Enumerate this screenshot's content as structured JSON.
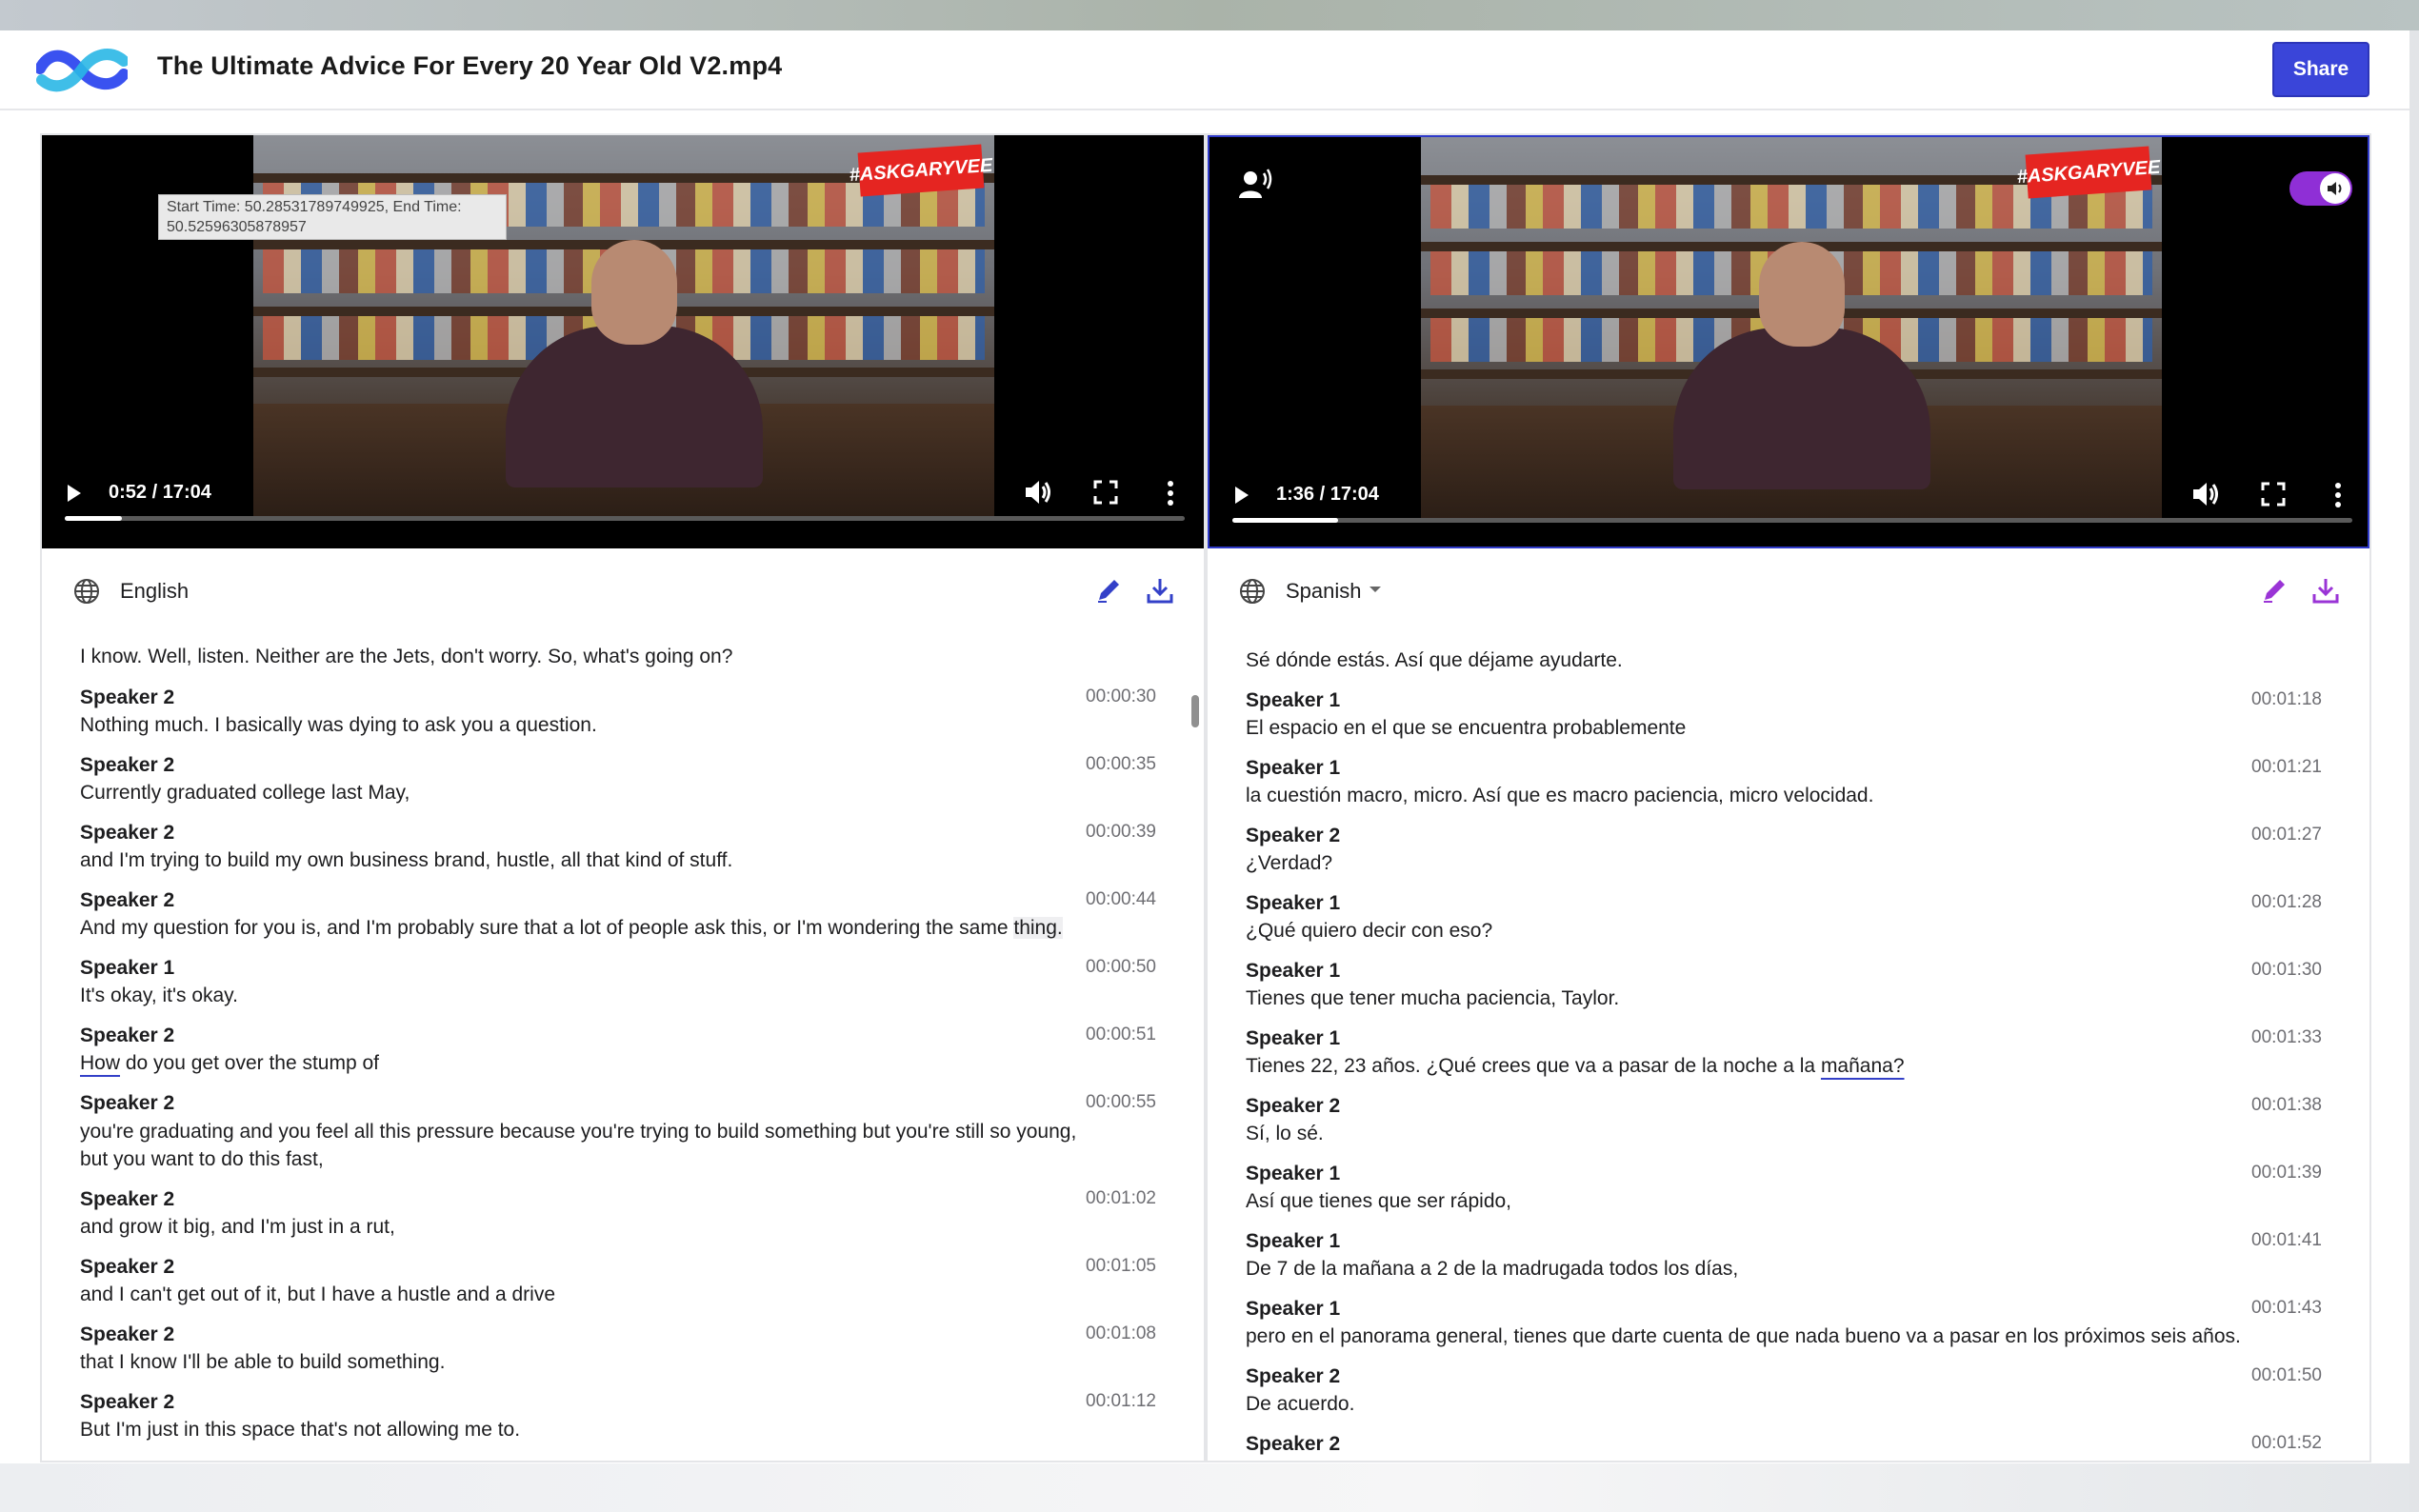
{
  "app": {
    "title": "The Ultimate Advice For Every 20 Year Old V2.mp4",
    "share_label": "Share",
    "accent_color": "#3a45d9"
  },
  "left_panel": {
    "video": {
      "time": "0:52 / 17:04",
      "progress": 0.051,
      "tooltip": "Start Time: 50.28531789749925, End Time: 50.52596305878957",
      "badge": "#ASKGARYVEE"
    },
    "language": "English",
    "transcript": [
      {
        "speaker": "",
        "time": "",
        "text": "I know. Well, listen. Neither are the Jets, don't worry. So, what's going on?"
      },
      {
        "speaker": "Speaker 2",
        "time": "00:00:30",
        "text": "Nothing much. I basically was dying to ask you a question."
      },
      {
        "speaker": "Speaker 2",
        "time": "00:00:35",
        "text": "Currently graduated college last May,"
      },
      {
        "speaker": "Speaker 2",
        "time": "00:00:39",
        "text": "and I'm trying to build my own business brand, hustle, all that kind of stuff."
      },
      {
        "speaker": "Speaker 2",
        "time": "00:00:44",
        "text_pre": "And my question for you is, and I'm probably sure that a lot of people ask this, or I'm wondering the same ",
        "text_hl": "thing."
      },
      {
        "speaker": "Speaker 1",
        "time": "00:00:50",
        "text": "It's okay, it's okay."
      },
      {
        "speaker": "Speaker 2",
        "time": "00:00:51",
        "text_ul": "How",
        "text_post": " do you get over the stump of"
      },
      {
        "speaker": "Speaker 2",
        "time": "00:00:55",
        "text": "you're graduating and you feel all this pressure because you're trying to build something but you're still so young, but you want to do this fast,"
      },
      {
        "speaker": "Speaker 2",
        "time": "00:01:02",
        "text": "and grow it big, and I'm just in a rut,"
      },
      {
        "speaker": "Speaker 2",
        "time": "00:01:05",
        "text": "and I can't get out of it, but I have a hustle and a drive"
      },
      {
        "speaker": "Speaker 2",
        "time": "00:01:08",
        "text": "that I know I'll be able to build something."
      },
      {
        "speaker": "Speaker 2",
        "time": "00:01:12",
        "text": "But I'm just in this space that's not allowing me to."
      }
    ]
  },
  "right_panel": {
    "video": {
      "time": "1:36 / 17:04",
      "progress": 0.094,
      "badge": "#ASKGARYVEE",
      "dub_toggle_on": true
    },
    "language": "Spanish",
    "transcript": [
      {
        "speaker": "",
        "time": "",
        "text": "Sé dónde estás. Así que déjame ayudarte."
      },
      {
        "speaker": "Speaker 1",
        "time": "00:01:18",
        "text": "El espacio en el que se encuentra probablemente"
      },
      {
        "speaker": "Speaker 1",
        "time": "00:01:21",
        "text": "la cuestión macro, micro. Así que es macro paciencia, micro velocidad."
      },
      {
        "speaker": "Speaker 2",
        "time": "00:01:27",
        "text": "¿Verdad?"
      },
      {
        "speaker": "Speaker 1",
        "time": "00:01:28",
        "text": "¿Qué quiero decir con eso?"
      },
      {
        "speaker": "Speaker 1",
        "time": "00:01:30",
        "text": "Tienes que tener mucha paciencia, Taylor."
      },
      {
        "speaker": "Speaker 1",
        "time": "00:01:33",
        "text_pre": "Tienes 22, 23 años. ¿Qué crees que va a pasar de la noche a la ",
        "text_ul": "mañana?"
      },
      {
        "speaker": "Speaker 2",
        "time": "00:01:38",
        "text": "Sí, lo sé."
      },
      {
        "speaker": "Speaker 1",
        "time": "00:01:39",
        "text": "Así que tienes que ser rápido,"
      },
      {
        "speaker": "Speaker 1",
        "time": "00:01:41",
        "text": "De 7 de la mañana a 2 de la madrugada todos los días,"
      },
      {
        "speaker": "Speaker 1",
        "time": "00:01:43",
        "text": "pero en el panorama general, tienes que darte cuenta de que nada bueno va a pasar en los próximos seis años."
      },
      {
        "speaker": "Speaker 2",
        "time": "00:01:50",
        "text": "De acuerdo."
      },
      {
        "speaker": "Speaker 2",
        "time": "00:01:52",
        "text": ""
      }
    ]
  },
  "icons": {
    "logo": "app-logo",
    "globe": "globe-icon",
    "edit": "pencil-icon",
    "download": "download-icon",
    "play": "play-icon",
    "volume": "volume-icon",
    "fullscreen": "fullscreen-icon",
    "more": "more-vertical-icon",
    "voice": "voice-icon"
  }
}
